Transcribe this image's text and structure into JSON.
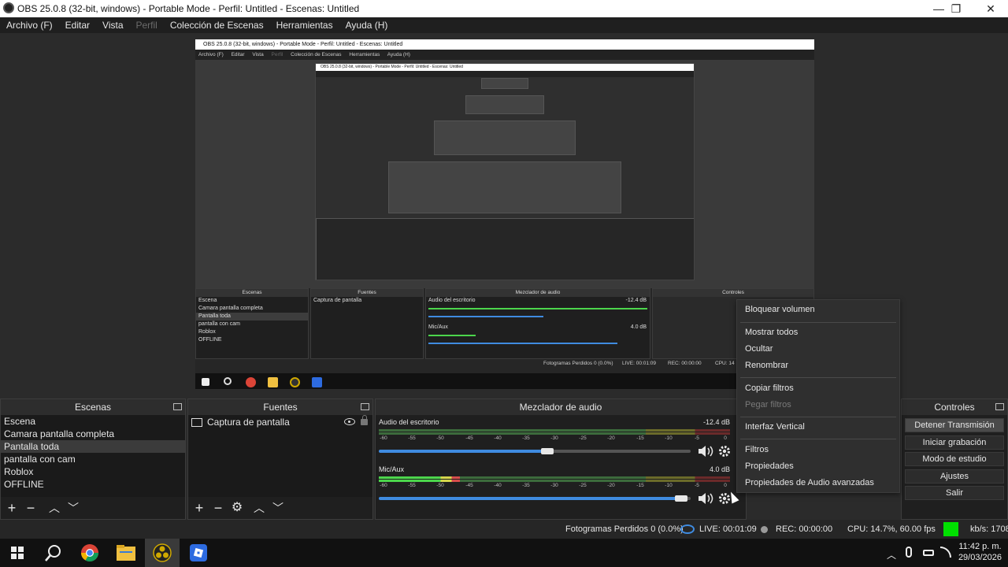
{
  "window": {
    "title": "OBS 25.0.8 (32-bit, windows) - Portable Mode - Perfil: Untitled - Escenas: Untitled",
    "min_glyph": "—",
    "max_glyph": "❐",
    "close_glyph": "✕"
  },
  "menu": [
    {
      "label": "Archivo (F)",
      "disabled": false
    },
    {
      "label": "Editar",
      "disabled": false
    },
    {
      "label": "Vista",
      "disabled": false
    },
    {
      "label": "Perfil",
      "disabled": true
    },
    {
      "label": "Colección de Escenas",
      "disabled": false
    },
    {
      "label": "Herramientas",
      "disabled": false
    },
    {
      "label": "Ayuda (H)",
      "disabled": false
    }
  ],
  "nested": {
    "title": "OBS 25.0.8 (32-bit, windows) - Portable Mode - Perfil: Untitled - Escenas: Untitled",
    "menu": [
      "Archivo (F)",
      "Editar",
      "Vista",
      "Perfil",
      "Colección de Escenas",
      "Herramientas",
      "Ayuda (H)"
    ],
    "inner_title": "OBS 25.0.8 (32-bit, windows) - Portable Mode - Perfil: Untitled - Escenas: Untitled",
    "scenes_head": "Escenas",
    "sources_head": "Fuentes",
    "mixer_head": "Mezclador de audio",
    "controls_head": "Controles",
    "scenes": [
      "Escena",
      "Camara pantalla completa",
      "Pantalla toda",
      "pantalla con cam",
      "Roblox",
      "OFFLINE"
    ],
    "source": "Captura de pantalla",
    "desktop_label": "Audio del escritorio",
    "desktop_db": "-12.4 dB",
    "mic_label": "Mic/Aux",
    "mic_db": "4.0 dB",
    "status": "Fotogramas Perdidos 0 (0.0%)",
    "live": "LIVE: 00:01:09",
    "rec": "REC: 00:00:00",
    "cpu": "CPU: 14"
  },
  "scenes": {
    "title": "Escenas",
    "items": [
      "Escena",
      "Camara pantalla completa",
      "Pantalla toda",
      "pantalla con cam",
      "Roblox",
      "OFFLINE"
    ],
    "selected_index": 2
  },
  "sources": {
    "title": "Fuentes",
    "items": [
      {
        "label": "Captura de pantalla",
        "icon": "monitor-icon",
        "visible": true,
        "locked": false
      }
    ]
  },
  "mixer": {
    "title": "Mezclador de audio",
    "ticks": [
      "-60",
      "-55",
      "-50",
      "-45",
      "-40",
      "-35",
      "-30",
      "-25",
      "-20",
      "-15",
      "-10",
      "-5",
      "0"
    ],
    "channels": [
      {
        "name": "Audio del escritorio",
        "db": "-12.4 dB",
        "level": 0.0,
        "volume": 0.54
      },
      {
        "name": "Mic/Aux",
        "db": "4.0 dB",
        "level": 0.23,
        "volume": 0.97
      }
    ]
  },
  "controls": {
    "title": "Controles",
    "buttons": [
      "Detener Transmisión",
      "Iniciar grabación",
      "Modo de estudio",
      "Ajustes",
      "Salir"
    ],
    "active_index": 0
  },
  "context_menu": {
    "items": [
      "Bloquear volumen",
      "Mostrar todos",
      "Ocultar",
      "Renombrar",
      "Copiar filtros",
      "Pegar filtros",
      "Interfaz Vertical",
      "Filtros",
      "Propiedades",
      "Propiedades de Audio avanzadas"
    ],
    "disabled": [
      5
    ]
  },
  "statusbar": {
    "dropped": "Fotogramas Perdidos 0 (0.0%)",
    "live": "LIVE: 00:01:09",
    "rec": "REC: 00:00:00",
    "cpu": "CPU: 14.7%, 60.00 fps",
    "kbps": "kb/s: 1708",
    "bitrate_color": "#00e000"
  },
  "taskbar": {
    "time": "11:42 p. m.",
    "date": "29/03/2026",
    "apps": [
      "windows-start-icon",
      "search-icon",
      "chrome-icon",
      "file-explorer-icon",
      "obs-icon",
      "roblox-icon"
    ]
  },
  "colors": {
    "accent_blue": "#3f8be0",
    "meter_green": "#4cd64c",
    "meter_yellow": "#d6d64c",
    "meter_red": "#d64c4c"
  }
}
